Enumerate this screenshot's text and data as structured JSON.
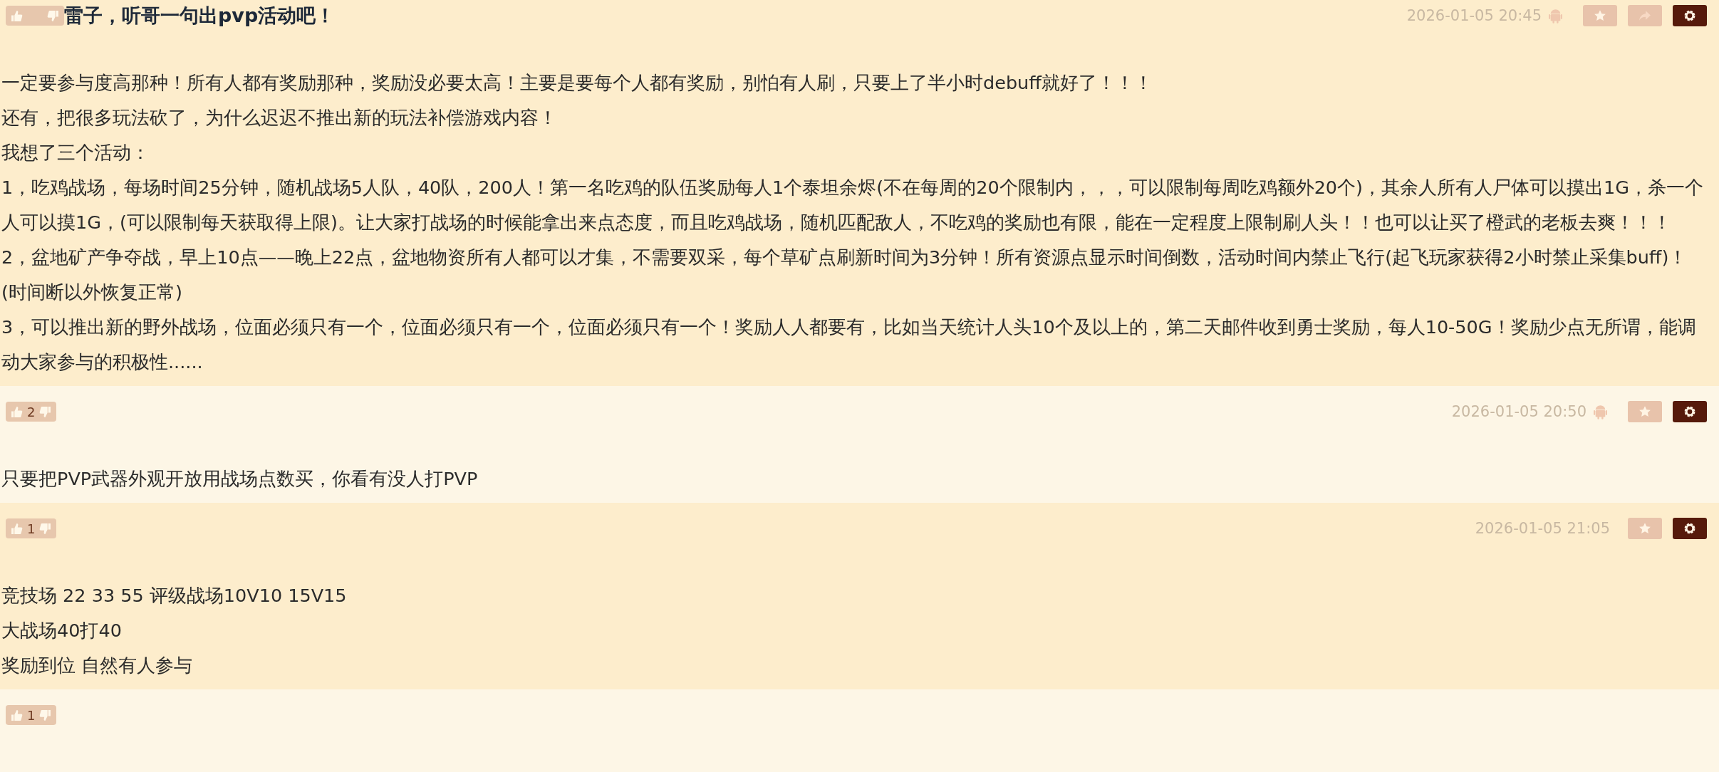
{
  "posts": [
    {
      "highlighted": true,
      "title": "雷子，听哥一句出pvp活动吧！",
      "time": "2026-01-05 20:45",
      "android": true,
      "actions": [
        {
          "kind": "star"
        },
        {
          "kind": "share"
        },
        {
          "kind": "settings"
        }
      ],
      "paragraphs": [
        "一定要参与度高那种！所有人都有奖励那种，奖励没必要太高！主要是要每个人都有奖励，别怕有人刷，只要上了半小时debuff就好了！！！",
        "还有，把很多玩法砍了，为什么迟迟不推出新的玩法补偿游戏内容！",
        "我想了三个活动：",
        "1，吃鸡战场，每场时间25分钟，随机战场5人队，40队，200人！第一名吃鸡的队伍奖励每人1个泰坦余烬(不在每周的20个限制内，，，可以限制每周吃鸡额外20个)，其余人所有人尸体可以摸出1G，杀一个人可以摸1G，(可以限制每天获取得上限)。让大家打战场的时候能拿出来点态度，而且吃鸡战场，随机匹配敌人，不吃鸡的奖励也有限，能在一定程度上限制刷人头！！也可以让买了橙武的老板去爽！！！",
        "2，盆地矿产争夺战，早上10点——晚上22点，盆地物资所有人都可以才集，不需要双采，每个草矿点刷新时间为3分钟！所有资源点显示时间倒数，活动时间内禁止飞行(起飞玩家获得2小时禁止采集buff)！(时间断以外恢复正常)",
        "3，可以推出新的野外战场，位面必须只有一个，位面必须只有一个，位面必须只有一个！奖励人人都要有，比如当天统计人头10个及以上的，第二天邮件收到勇士奖励，每人10-50G！奖励少点无所谓，能调动大家参与的积极性......"
      ]
    },
    {
      "highlighted": false,
      "vote_count": "2",
      "time": "2026-01-05 20:50",
      "android": true,
      "actions": [
        {
          "kind": "star"
        },
        {
          "kind": "settings"
        }
      ],
      "paragraphs": [
        "只要把PVP武器外观开放用战场点数买，你看有没人打PVP"
      ]
    },
    {
      "highlighted": true,
      "vote_count": "1",
      "time": "2026-01-05 21:05",
      "android": false,
      "actions": [
        {
          "kind": "star"
        },
        {
          "kind": "settings"
        }
      ],
      "paragraphs": [
        "竞技场 22 33 55 评级战场10V10 15V15",
        "大战场40打40",
        "奖励到位 自然有人参与"
      ]
    },
    {
      "highlighted": false,
      "vote_count": "1"
    }
  ]
}
